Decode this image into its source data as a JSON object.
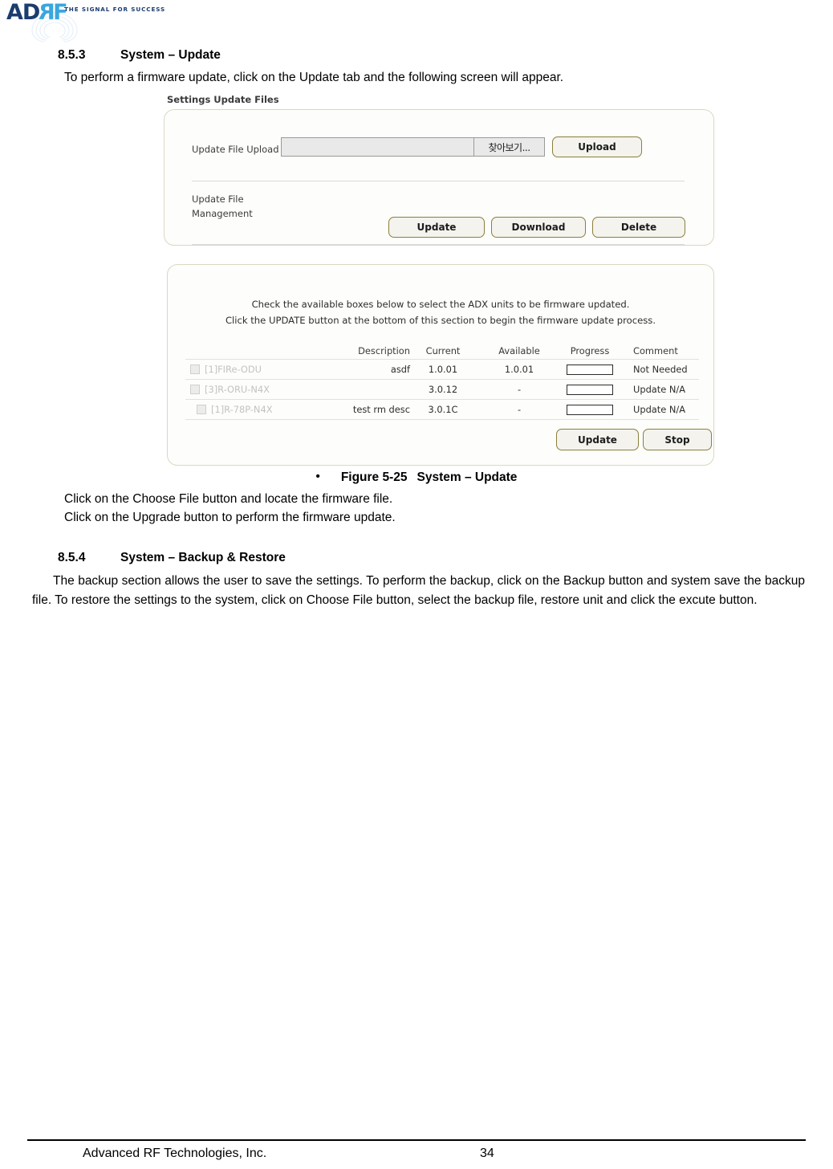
{
  "header": {
    "logo_text_ad": "AD",
    "logo_text_r": "R",
    "logo_text_f": "F",
    "tagline": "THE SIGNAL FOR SUCCESS"
  },
  "sections": {
    "s853": {
      "number": "8.5.3",
      "title": "System – Update",
      "intro": "To perform a firmware update, click on the Update tab and the following screen will appear."
    },
    "s854": {
      "number": "8.5.4",
      "title": "System – Backup & Restore",
      "body": "The backup section allows the user to save the settings. To perform the backup, click on the Backup button and system save the backup file.  To restore the settings to the system, click on Choose File button, select the backup file, restore unit and click the excute button."
    }
  },
  "figure": {
    "bullet": "•",
    "label": "Figure 5-25",
    "title": "System – Update"
  },
  "steps": [
    "Click on the Choose File button and locate the firmware file.",
    "Click on the Upgrade button to perform the firmware update."
  ],
  "screenshot": {
    "panel1": {
      "title": "Settings Update Files",
      "upload_label": "Update File Upload",
      "file_value": "",
      "browse_label": "찾아보기...",
      "upload_button": "Upload",
      "management_label_line1": "Update File",
      "management_label_line2": "Management",
      "buttons": [
        "Update",
        "Download",
        "Delete"
      ]
    },
    "panel2": {
      "instructions": [
        "Check the available boxes below to select the ADX units to be firmware updated.",
        "Click the UPDATE button at the bottom of this section to begin the firmware update process."
      ],
      "columns": [
        "Description",
        "Current",
        "Available",
        "Progress",
        "Comment"
      ],
      "rows": [
        {
          "unit": "[1]FIRe-ODU",
          "description": "asdf",
          "current": "1.0.01",
          "available": "1.0.01",
          "progress": "",
          "comment": "Not Needed",
          "checked": false
        },
        {
          "unit": "[3]R-ORU-N4X",
          "description": "",
          "current": "3.0.12",
          "available": "-",
          "progress": "",
          "comment": "Update N/A",
          "checked": false
        },
        {
          "unit": "[1]R-78P-N4X",
          "description": "test rm desc",
          "current": "3.0.1C",
          "available": "-",
          "progress": "",
          "comment": "Update N/A",
          "checked": false
        }
      ],
      "buttons": [
        "Update",
        "Stop"
      ]
    }
  },
  "footer": {
    "company": "Advanced RF Technologies, Inc.",
    "page": "34"
  },
  "colors": {
    "logo_dark": "#1b3c6e",
    "logo_light": "#3aa6dd",
    "panel_border": "#ded6c3",
    "button_border": "#8a7f3c"
  }
}
